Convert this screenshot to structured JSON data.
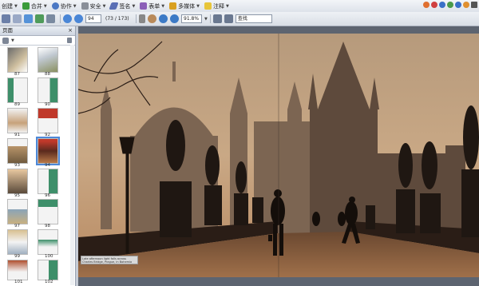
{
  "menus": [
    {
      "label": "创建"
    },
    {
      "label": "合并"
    },
    {
      "label": "协作"
    },
    {
      "label": "安全"
    },
    {
      "label": "签名"
    },
    {
      "label": "表单"
    },
    {
      "label": "多媒体"
    },
    {
      "label": "注释"
    }
  ],
  "nav": {
    "page_value": "94",
    "page_count": "(73 / 173)",
    "zoom": "91.8%",
    "find_value": "查找"
  },
  "panel": {
    "title": "页面",
    "close": "×"
  },
  "thumbnails": [
    {
      "label": "87"
    },
    {
      "label": "88"
    },
    {
      "label": "89"
    },
    {
      "label": "90"
    },
    {
      "label": "91"
    },
    {
      "label": "92"
    },
    {
      "label": "93"
    },
    {
      "label": "94"
    },
    {
      "label": "95"
    },
    {
      "label": "96"
    },
    {
      "label": "97"
    },
    {
      "label": "98"
    },
    {
      "label": "99"
    },
    {
      "label": "100"
    },
    {
      "label": "101"
    },
    {
      "label": "102"
    }
  ],
  "photo_caption": "Late afternoon light falls across Charles Bridge, Prague, in Bohemia"
}
